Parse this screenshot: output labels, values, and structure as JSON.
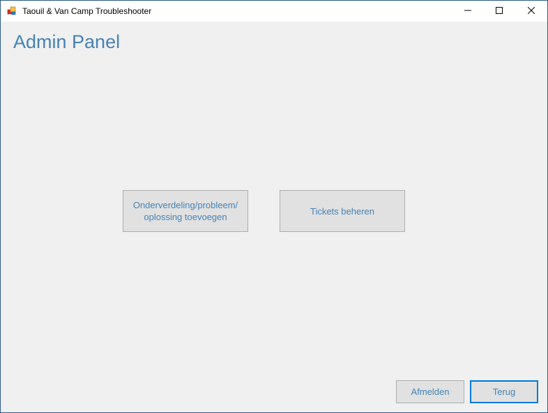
{
  "window": {
    "title": "Taouil & Van Camp Troubleshooter",
    "icon": "app-icon",
    "controls": {
      "minimize_icon": "minimize-icon",
      "maximize_icon": "maximize-icon",
      "close_icon": "close-icon"
    }
  },
  "main": {
    "title": "Admin Panel",
    "buttons": {
      "add_label": "Onderverdeling/probleem/ oplossing toevoegen",
      "tickets_label": "Tickets beheren"
    }
  },
  "footer": {
    "logout_label": "Afmelden",
    "back_label": "Terug"
  },
  "colors": {
    "accent_text": "#4682b4",
    "focus_border": "#0078d7",
    "form_background": "#f0f0f0",
    "button_background": "#e1e1e1"
  }
}
